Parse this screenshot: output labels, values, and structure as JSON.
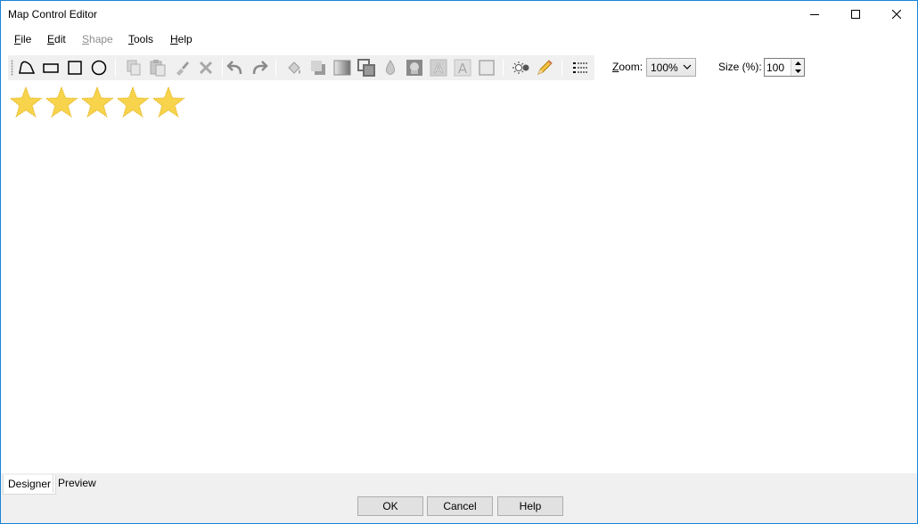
{
  "window": {
    "title": "Map Control Editor"
  },
  "menu": [
    {
      "label": "File",
      "key": "F",
      "rest": "ile",
      "enabled": true
    },
    {
      "label": "Edit",
      "key": "E",
      "rest": "dit",
      "enabled": true
    },
    {
      "label": "Shape",
      "key": "S",
      "rest": "hape",
      "enabled": false
    },
    {
      "label": "Tools",
      "key": "T",
      "rest": "ools",
      "enabled": true
    },
    {
      "label": "Help",
      "key": "H",
      "rest": "elp",
      "enabled": true
    }
  ],
  "toolbar": {
    "zoom_label": "Zoom:",
    "zoom_label_key": "Z",
    "zoom_label_rest": "oom:",
    "zoom_value": "100%",
    "size_label": "Size (%):",
    "size_value": "100"
  },
  "canvas": {
    "star_count": 5,
    "star_color": "#f7d44c",
    "star_outline": "#e8b820"
  },
  "tabs": [
    "Designer",
    "Preview"
  ],
  "buttons": {
    "ok": "OK",
    "cancel": "Cancel",
    "help": "Help"
  }
}
